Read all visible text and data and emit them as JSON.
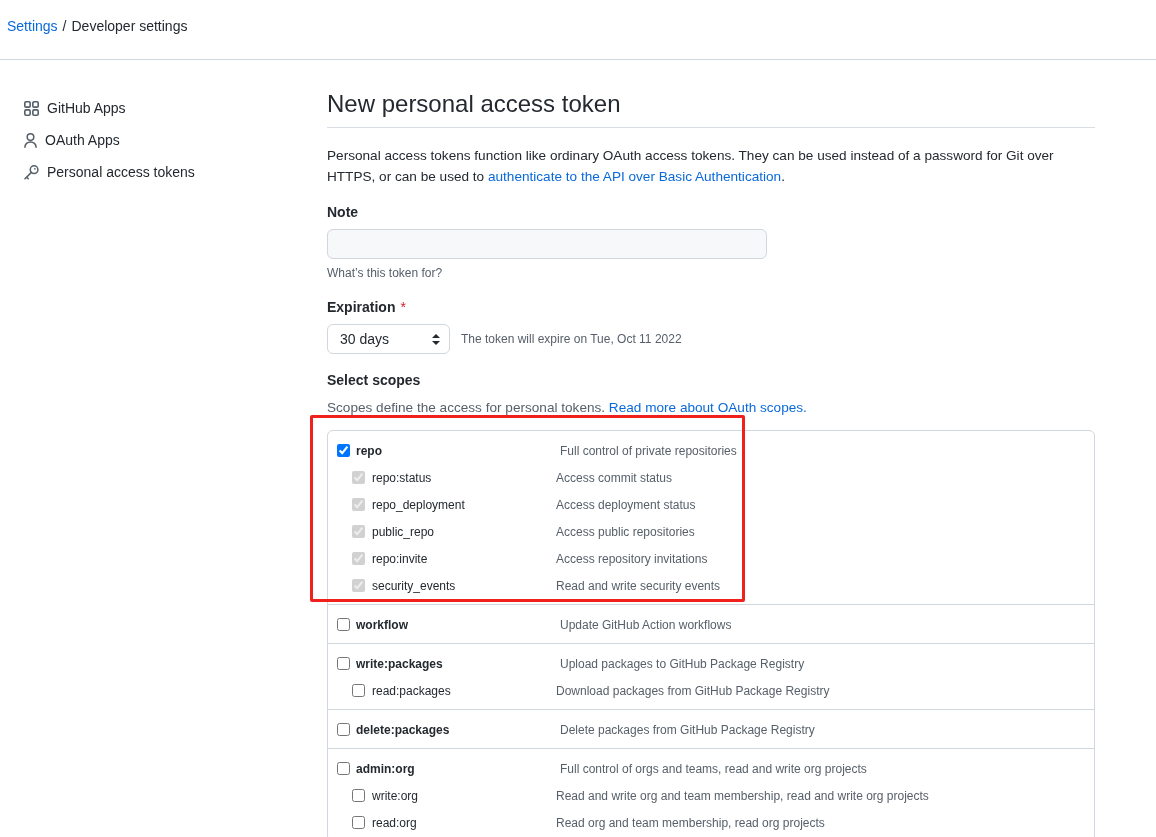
{
  "breadcrumb": {
    "separator": "/",
    "items": [
      {
        "label": "Settings",
        "kind": "link"
      },
      {
        "label": "Developer settings",
        "kind": "current"
      }
    ]
  },
  "sidebar": {
    "items": [
      {
        "label": "GitHub Apps",
        "kind": "apps"
      },
      {
        "label": "OAuth Apps",
        "kind": "person"
      },
      {
        "label": "Personal access tokens",
        "kind": "key"
      }
    ]
  },
  "page": {
    "title": "New personal access token",
    "intro": {
      "text": "Personal access tokens function like ordinary OAuth access tokens. They can be used instead of a password for Git over HTTPS, or can be used to ",
      "link": "authenticate to the API over Basic Authentication",
      "after": "."
    }
  },
  "note": {
    "label": "Note",
    "hint": "What’s this token for?"
  },
  "expiration": {
    "label": "Expiration",
    "required_mark": "*",
    "value": "30 days",
    "info": "The token will expire on Tue, Oct 11 2022"
  },
  "scopes": {
    "label": "Select scopes",
    "intro": "Scopes define the access for personal tokens. ",
    "link": "Read more about OAuth scopes.",
    "groups": [
      {
        "name": "repo",
        "description": "Full control of private repositories",
        "checked": true,
        "disabled": false,
        "highlighted": true,
        "children": [
          {
            "name": "repo:status",
            "description": "Access commit status",
            "checked": true,
            "disabled": true
          },
          {
            "name": "repo_deployment",
            "description": "Access deployment status",
            "checked": true,
            "disabled": true
          },
          {
            "name": "public_repo",
            "description": "Access public repositories",
            "checked": true,
            "disabled": true
          },
          {
            "name": "repo:invite",
            "description": "Access repository invitations",
            "checked": true,
            "disabled": true
          },
          {
            "name": "security_events",
            "description": "Read and write security events",
            "checked": true,
            "disabled": true
          }
        ]
      },
      {
        "name": "workflow",
        "description": "Update GitHub Action workflows",
        "checked": false,
        "disabled": false,
        "highlighted": false
      },
      {
        "name": "write:packages",
        "description": "Upload packages to GitHub Package Registry",
        "checked": false,
        "disabled": false,
        "highlighted": false,
        "children": [
          {
            "name": "read:packages",
            "description": "Download packages from GitHub Package Registry",
            "checked": false,
            "disabled": false
          }
        ]
      },
      {
        "name": "delete:packages",
        "description": "Delete packages from GitHub Package Registry",
        "checked": false,
        "disabled": false,
        "highlighted": false
      },
      {
        "name": "admin:org",
        "description": "Full control of orgs and teams, read and write org projects",
        "checked": false,
        "disabled": false,
        "highlighted": false,
        "children": [
          {
            "name": "write:org",
            "description": "Read and write org and team membership, read and write org projects",
            "checked": false,
            "disabled": false
          },
          {
            "name": "read:org",
            "description": "Read org and team membership, read org projects",
            "checked": false,
            "disabled": false
          }
        ]
      }
    ]
  }
}
